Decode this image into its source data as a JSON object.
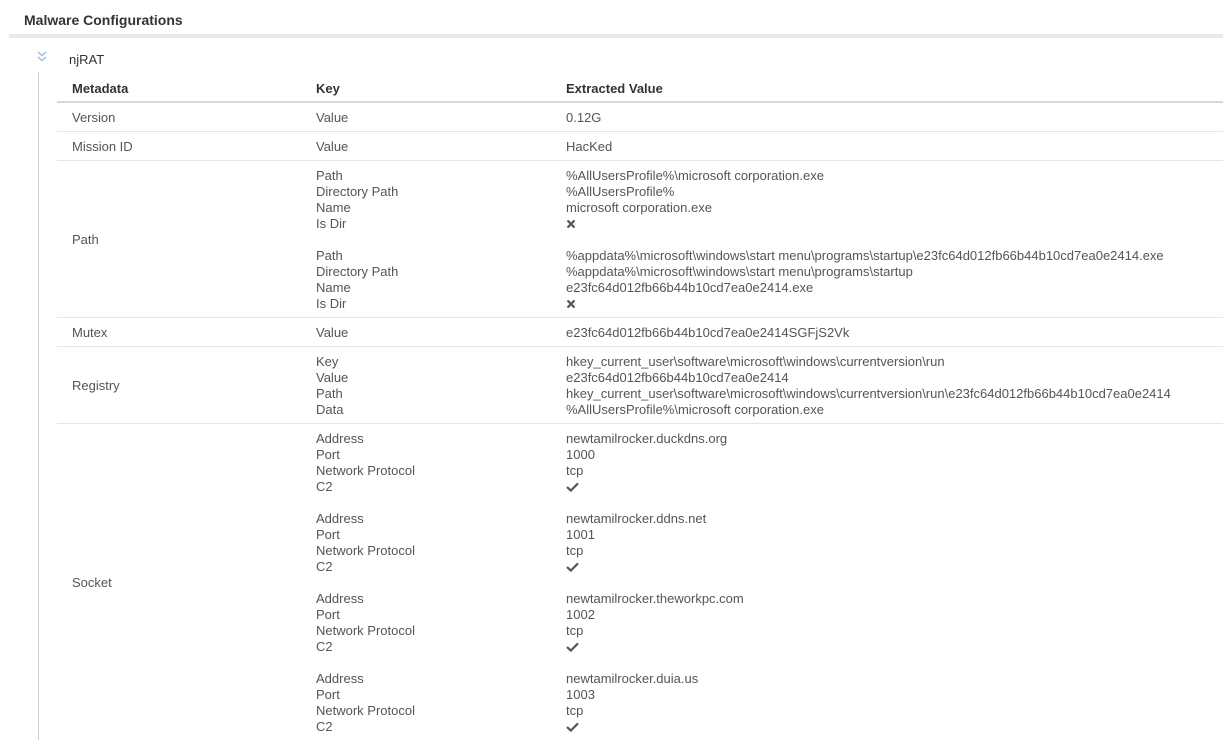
{
  "section": {
    "title": "Malware Configurations"
  },
  "family": {
    "name": "njRAT",
    "toggle_icon": "chevron-double-down-icon"
  },
  "table": {
    "headers": {
      "metadata": "Metadata",
      "key": "Key",
      "value": "Extracted Value"
    },
    "rows": {
      "version": {
        "meta": "Version",
        "key": "Value",
        "value": "0.12G"
      },
      "mission": {
        "meta": "Mission ID",
        "key": "Value",
        "value": "HacKed"
      },
      "path": {
        "meta": "Path",
        "groups": [
          {
            "k_path": "Path",
            "k_dir": "Directory Path",
            "k_name": "Name",
            "k_isdir": "Is Dir",
            "path": "%AllUsersProfile%\\microsoft corporation.exe",
            "dir": "%AllUsersProfile%",
            "name": "microsoft corporation.exe",
            "isdir_icon": "cross-icon"
          },
          {
            "k_path": "Path",
            "k_dir": "Directory Path",
            "k_name": "Name",
            "k_isdir": "Is Dir",
            "path": "%appdata%\\microsoft\\windows\\start menu\\programs\\startup\\e23fc64d012fb66b44b10cd7ea0e2414.exe",
            "dir": "%appdata%\\microsoft\\windows\\start menu\\programs\\startup",
            "name": "e23fc64d012fb66b44b10cd7ea0e2414.exe",
            "isdir_icon": "cross-icon"
          }
        ]
      },
      "mutex": {
        "meta": "Mutex",
        "key": "Value",
        "value": "e23fc64d012fb66b44b10cd7ea0e2414SGFjS2Vk"
      },
      "registry": {
        "meta": "Registry",
        "k_key": "Key",
        "k_value": "Value",
        "k_path": "Path",
        "k_data": "Data",
        "key": "hkey_current_user\\software\\microsoft\\windows\\currentversion\\run",
        "value": "e23fc64d012fb66b44b10cd7ea0e2414",
        "path": "hkey_current_user\\software\\microsoft\\windows\\currentversion\\run\\e23fc64d012fb66b44b10cd7ea0e2414",
        "data": "%AllUsersProfile%\\microsoft corporation.exe"
      },
      "socket": {
        "meta": "Socket",
        "groups": [
          {
            "k_addr": "Address",
            "k_port": "Port",
            "k_proto": "Network Protocol",
            "k_c2": "C2",
            "addr": "newtamilrocker.duckdns.org",
            "port": "1000",
            "proto": "tcp",
            "c2_icon": "check-icon"
          },
          {
            "k_addr": "Address",
            "k_port": "Port",
            "k_proto": "Network Protocol",
            "k_c2": "C2",
            "addr": "newtamilrocker.ddns.net",
            "port": "1001",
            "proto": "tcp",
            "c2_icon": "check-icon"
          },
          {
            "k_addr": "Address",
            "k_port": "Port",
            "k_proto": "Network Protocol",
            "k_c2": "C2",
            "addr": "newtamilrocker.theworkpc.com",
            "port": "1002",
            "proto": "tcp",
            "c2_icon": "check-icon"
          },
          {
            "k_addr": "Address",
            "k_port": "Port",
            "k_proto": "Network Protocol",
            "k_c2": "C2",
            "addr": "newtamilrocker.duia.us",
            "port": "1003",
            "proto": "tcp",
            "c2_icon": "check-icon"
          }
        ]
      }
    }
  },
  "colors": {
    "accent": "#a9c3dd",
    "text": "#555555",
    "icon": "#555555"
  }
}
